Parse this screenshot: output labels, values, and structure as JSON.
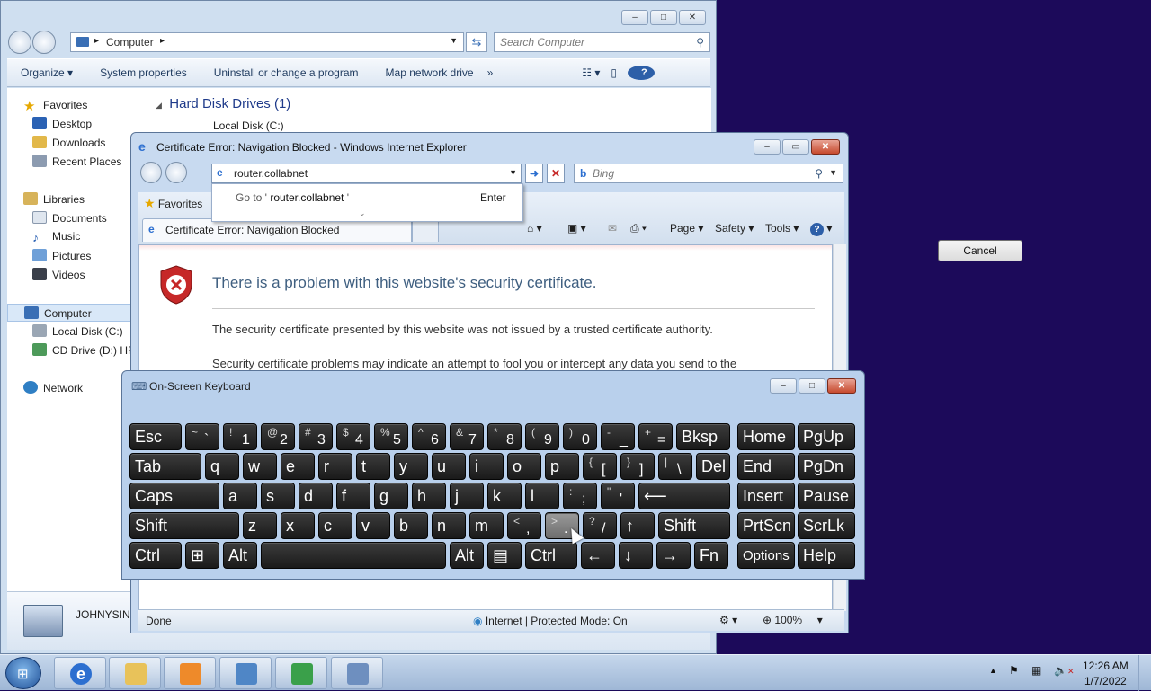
{
  "explorer": {
    "address": "Computer",
    "search_placeholder": "Search Computer",
    "toolbar": [
      "Organize ▾",
      "System properties",
      "Uninstall or change a program",
      "Map network drive",
      "»"
    ],
    "nav": {
      "favorites": "Favorites",
      "desktop": "Desktop",
      "downloads": "Downloads",
      "recent": "Recent Places",
      "libraries": "Libraries",
      "documents": "Documents",
      "music": "Music",
      "pictures": "Pictures",
      "videos": "Videos",
      "computer": "Computer",
      "local_disk": "Local Disk (C:)",
      "cd_drive": "CD Drive (D:) HR",
      "network": "Network"
    },
    "group_header": "Hard Disk Drives (1)",
    "drive_label": "Local Disk (C:)",
    "details_name": "JOHNYSIN"
  },
  "ie": {
    "title": "Certificate Error: Navigation Blocked - Windows Internet Explorer",
    "url": "router.collabnet",
    "search_placeholder": "Bing",
    "dropdown_goto_prefix": "Go to '",
    "dropdown_goto_url": "router.collabnet",
    "dropdown_goto_suffix": "'",
    "dropdown_enter": "Enter",
    "favorites": "Favorites",
    "tab_title": "Certificate Error: Navigation Blocked",
    "cmd": {
      "page": "Page ▾",
      "safety": "Safety ▾",
      "tools": "Tools ▾"
    },
    "heading": "There is a problem with this website's security certificate.",
    "para1": "The security certificate presented by this website was not issued by a trusted certificate authority.",
    "para2": "Security certificate problems may indicate an attempt to fool you or intercept any data you send to the",
    "status_done": "Done",
    "status_zone": "Internet | Protected Mode: On",
    "zoom": "100%"
  },
  "osk": {
    "title": "On-Screen Keyboard",
    "rows": [
      [
        {
          "l": "Esc",
          "w": 58
        },
        {
          "s": "~",
          "b": "`",
          "w": 38
        },
        {
          "s": "!",
          "b": "1",
          "w": 38
        },
        {
          "s": "@",
          "b": "2",
          "w": 38
        },
        {
          "s": "#",
          "b": "3",
          "w": 38
        },
        {
          "s": "$",
          "b": "4",
          "w": 38
        },
        {
          "s": "%",
          "b": "5",
          "w": 38
        },
        {
          "s": "^",
          "b": "6",
          "w": 38
        },
        {
          "s": "&",
          "b": "7",
          "w": 38
        },
        {
          "s": "*",
          "b": "8",
          "w": 38
        },
        {
          "s": "(",
          "b": "9",
          "w": 38
        },
        {
          "s": ")",
          "b": "0",
          "w": 38
        },
        {
          "s": "-",
          "b": "_",
          "w": 38
        },
        {
          "s": "+",
          "b": "=",
          "w": 38
        },
        {
          "l": "Bksp",
          "w": 60
        }
      ],
      [
        {
          "l": "Tab",
          "w": 80
        },
        {
          "l": "q",
          "w": 38
        },
        {
          "l": "w",
          "w": 38
        },
        {
          "l": "e",
          "w": 38
        },
        {
          "l": "r",
          "w": 38
        },
        {
          "l": "t",
          "w": 38
        },
        {
          "l": "y",
          "w": 38
        },
        {
          "l": "u",
          "w": 38
        },
        {
          "l": "i",
          "w": 38
        },
        {
          "l": "o",
          "w": 38
        },
        {
          "l": "p",
          "w": 38
        },
        {
          "s": "{",
          "b": "[",
          "w": 38
        },
        {
          "s": "}",
          "b": "]",
          "w": 38
        },
        {
          "s": "|",
          "b": "\\",
          "w": 38
        },
        {
          "l": "Del",
          "w": 38
        }
      ],
      [
        {
          "l": "Caps",
          "w": 100
        },
        {
          "l": "a",
          "w": 38
        },
        {
          "l": "s",
          "w": 38
        },
        {
          "l": "d",
          "w": 38
        },
        {
          "l": "f",
          "w": 38
        },
        {
          "l": "g",
          "w": 38
        },
        {
          "l": "h",
          "w": 38
        },
        {
          "l": "j",
          "w": 38
        },
        {
          "l": "k",
          "w": 38
        },
        {
          "l": "l",
          "w": 38
        },
        {
          "s": ":",
          "b": ";",
          "w": 38
        },
        {
          "s": "\"",
          "b": "'",
          "w": 38
        },
        {
          "l": "⟵",
          "w": 102
        }
      ],
      [
        {
          "l": "Shift",
          "w": 122
        },
        {
          "l": "z",
          "w": 38
        },
        {
          "l": "x",
          "w": 38
        },
        {
          "l": "c",
          "w": 38
        },
        {
          "l": "v",
          "w": 38
        },
        {
          "l": "b",
          "w": 38
        },
        {
          "l": "n",
          "w": 38
        },
        {
          "l": "m",
          "w": 38
        },
        {
          "s": "<",
          "b": ",",
          "w": 38
        },
        {
          "s": ">",
          "b": ".",
          "w": 38,
          "pressed": true
        },
        {
          "s": "?",
          "b": "/",
          "w": 38
        },
        {
          "l": "↑",
          "w": 38
        },
        {
          "l": "Shift",
          "w": 80
        }
      ],
      [
        {
          "l": "Ctrl",
          "w": 58
        },
        {
          "l": "⊞",
          "w": 38
        },
        {
          "l": "Alt",
          "w": 38
        },
        {
          "l": "",
          "w": 206
        },
        {
          "l": "Alt",
          "w": 38
        },
        {
          "l": "▤",
          "w": 38
        },
        {
          "l": "Ctrl",
          "w": 58
        },
        {
          "l": "←",
          "w": 38
        },
        {
          "l": "↓",
          "w": 38
        },
        {
          "l": "→",
          "w": 38
        },
        {
          "l": "Fn",
          "w": 38
        }
      ]
    ],
    "side": [
      [
        {
          "l": "Home"
        },
        {
          "l": "PgUp"
        }
      ],
      [
        {
          "l": "End"
        },
        {
          "l": "PgDn"
        }
      ],
      [
        {
          "l": "Insert"
        },
        {
          "l": "Pause"
        }
      ],
      [
        {
          "l": "PrtScn"
        },
        {
          "l": "ScrLk"
        }
      ],
      [
        {
          "l": "Options",
          "small": true
        },
        {
          "l": "Help"
        }
      ]
    ]
  },
  "dialog": {
    "cancel": "Cancel"
  },
  "taskbar": {
    "time": "12:26 AM",
    "date": "1/7/2022",
    "apps": [
      "internet-explorer",
      "windows-explorer",
      "media-player",
      "control-panel",
      "network-transfer",
      "on-screen-keyboard"
    ]
  },
  "colors": {
    "desktop": "#1c0a5a",
    "heading_blue": "#3f5f80"
  }
}
